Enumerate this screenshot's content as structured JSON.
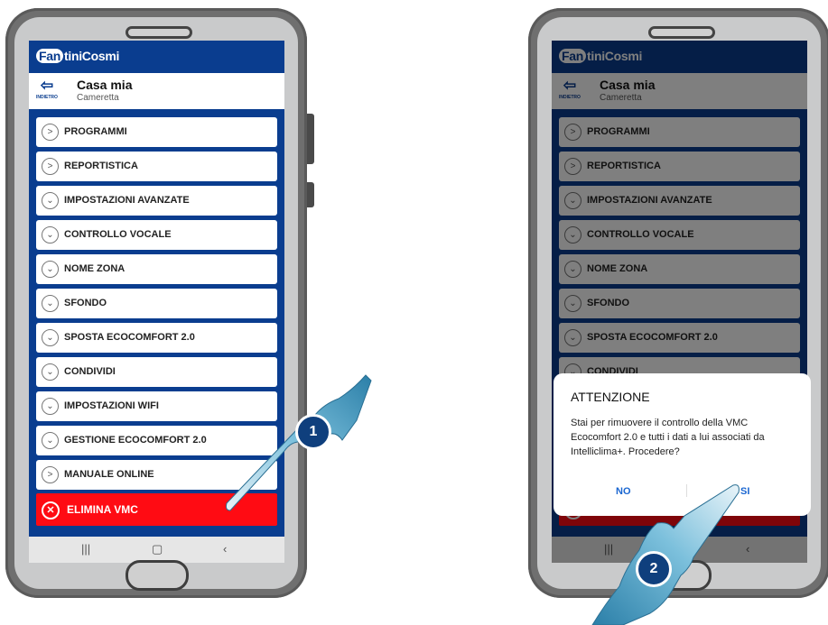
{
  "app": {
    "logo_text": "FantiniCosmi",
    "logo_prefix": "Fan",
    "logo_rest": "tiniCosmi"
  },
  "header": {
    "back_label": "INDIETRO",
    "title": "Casa mia",
    "subtitle": "Cameretta"
  },
  "menu_items": [
    {
      "label": "PROGRAMMI",
      "icon": "chevron-right"
    },
    {
      "label": "REPORTISTICA",
      "icon": "chevron-right"
    },
    {
      "label": "IMPOSTAZIONI AVANZATE",
      "icon": "chevron-down"
    },
    {
      "label": "CONTROLLO VOCALE",
      "icon": "chevron-down"
    },
    {
      "label": "NOME ZONA",
      "icon": "chevron-down"
    },
    {
      "label": "SFONDO",
      "icon": "chevron-down"
    },
    {
      "label": "SPOSTA ECOCOMFORT 2.0",
      "icon": "chevron-down"
    },
    {
      "label": "CONDIVIDI",
      "icon": "chevron-down"
    },
    {
      "label": "IMPOSTAZIONI WIFI",
      "icon": "chevron-down"
    },
    {
      "label": "GESTIONE ECOCOMFORT 2.0",
      "icon": "chevron-down"
    },
    {
      "label": "MANUALE ONLINE",
      "icon": "chevron-right"
    }
  ],
  "delete_button": {
    "label": "ELIMINA VMC"
  },
  "dialog": {
    "title": "ATTENZIONE",
    "message": "Stai per rimuovere il controllo della VMC Ecocomfort 2.0 e tutti i dati a lui associati da Intelliclima+. Procedere?",
    "no_label": "NO",
    "yes_label": "SI"
  },
  "steps": [
    "1",
    "2"
  ],
  "colors": {
    "brand": "#0a3d8f",
    "danger": "#ff0b13",
    "dialog_button": "#1a66d1",
    "hand": "#4fa3c9"
  }
}
